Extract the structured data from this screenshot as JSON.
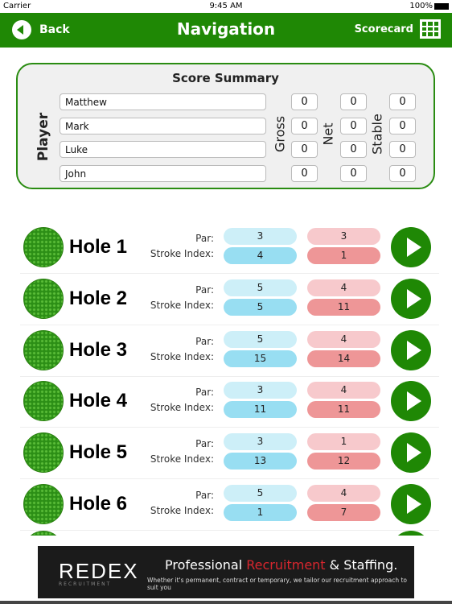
{
  "status": {
    "carrier": "Carrier",
    "time": "9:45 AM",
    "battery": "100%"
  },
  "header": {
    "back": "Back",
    "title": "Navigation",
    "scorecard": "Scorecard"
  },
  "summary": {
    "title": "Score Summary",
    "player_label": "Player",
    "gross_label": "Gross",
    "net_label": "Net",
    "stable_label": "Stable",
    "players": [
      {
        "name": "Matthew",
        "gross": "0",
        "net": "0",
        "stable": "0"
      },
      {
        "name": "Mark",
        "gross": "0",
        "net": "0",
        "stable": "0"
      },
      {
        "name": "Luke",
        "gross": "0",
        "net": "0",
        "stable": "0"
      },
      {
        "name": "John",
        "gross": "0",
        "net": "0",
        "stable": "0"
      }
    ]
  },
  "labels": {
    "par": "Par:",
    "si": "Stroke Index:"
  },
  "holes": [
    {
      "name": "Hole 1",
      "par_blue": "3",
      "si_blue": "4",
      "par_red": "3",
      "si_red": "1"
    },
    {
      "name": "Hole 2",
      "par_blue": "5",
      "si_blue": "5",
      "par_red": "4",
      "si_red": "11"
    },
    {
      "name": "Hole 3",
      "par_blue": "5",
      "si_blue": "15",
      "par_red": "4",
      "si_red": "14"
    },
    {
      "name": "Hole 4",
      "par_blue": "3",
      "si_blue": "11",
      "par_red": "4",
      "si_red": "11"
    },
    {
      "name": "Hole 5",
      "par_blue": "3",
      "si_blue": "13",
      "par_red": "1",
      "si_red": "12"
    },
    {
      "name": "Hole 6",
      "par_blue": "5",
      "si_blue": "1",
      "par_red": "4",
      "si_red": "7"
    }
  ],
  "ad": {
    "brand": "REDEX",
    "brand_sub": "RECRUITMENT",
    "headline_a": "Professional ",
    "headline_b": "Recruitment",
    "headline_c": " & Staffing.",
    "tagline": "Whether it's permanent, contract or temporary, we tailor our recruitment approach to suit you"
  },
  "colors": {
    "green": "#1f8805",
    "blue_light": "#cdeff8",
    "blue": "#98def2",
    "red_light": "#f7c9cc",
    "red": "#ee9697",
    "ad_red": "#d8262e"
  }
}
